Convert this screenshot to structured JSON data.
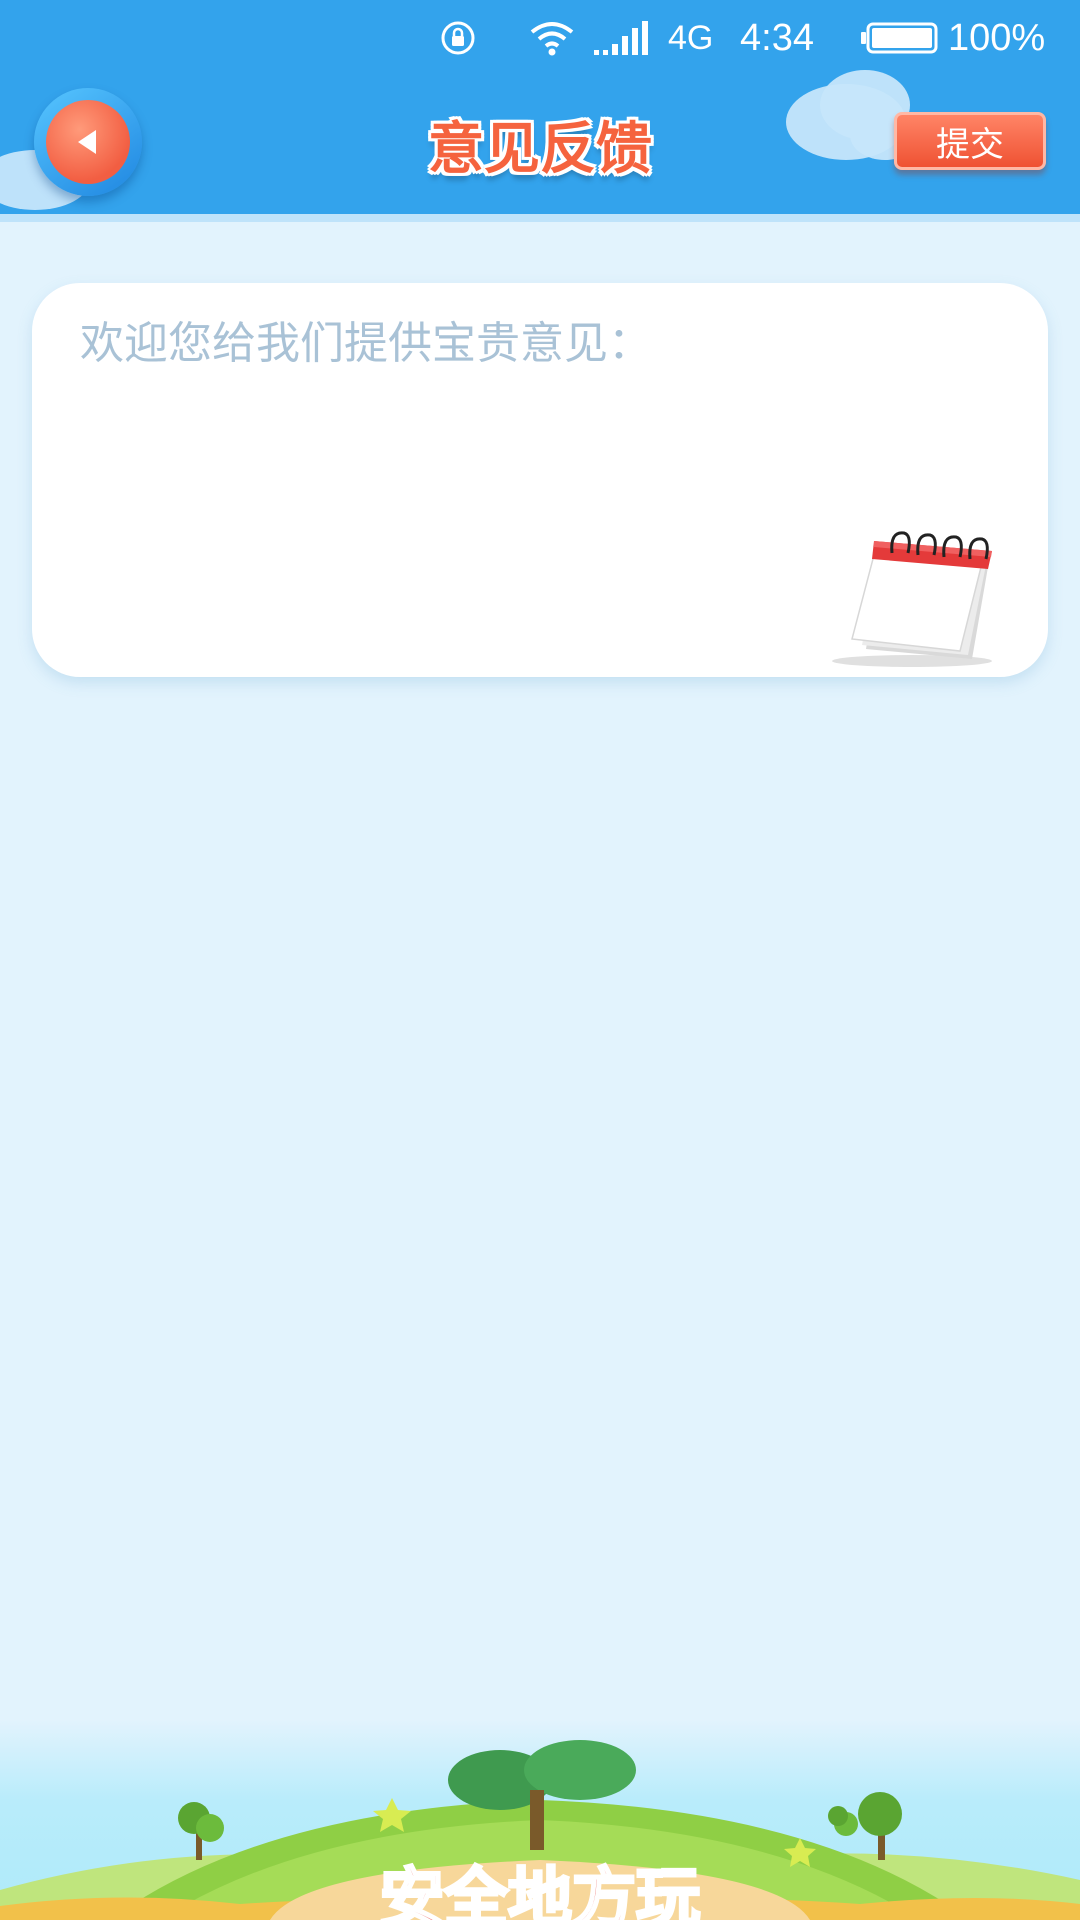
{
  "status_bar": {
    "network": "4G",
    "time": "4:34",
    "battery_pct": "100%",
    "icons": [
      "rotation-lock-icon",
      "wifi-icon",
      "signal-icon",
      "battery-icon"
    ]
  },
  "header": {
    "title": "意见反馈",
    "submit_label": "提交",
    "back_icon": "back-arrow-icon"
  },
  "feedback": {
    "placeholder": "欢迎您给我们提供宝贵意见：",
    "value": ""
  },
  "banner": {
    "logo_text": "安全地方玩"
  },
  "colors": {
    "header_bg": "#33a3ec",
    "page_bg": "#e2f3fd",
    "accent": "#f5633e",
    "placeholder": "#a9c2d6"
  }
}
